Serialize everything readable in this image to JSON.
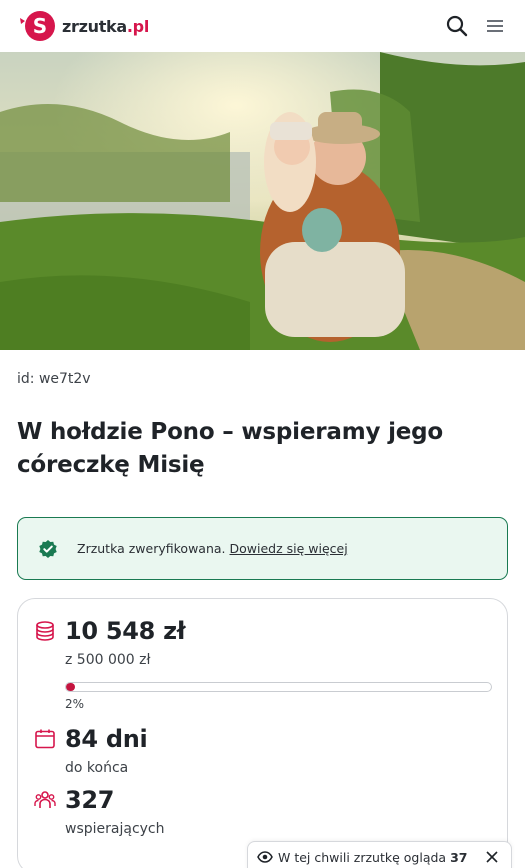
{
  "header": {
    "logo_text": "zrzutka",
    "logo_tld": ".pl",
    "search_icon": "search-icon",
    "menu_icon": "hamburger-menu-icon"
  },
  "campaign": {
    "id_label": "id: we7t2v",
    "title": "W hołdzie Pono – wspieramy jego córeczkę Misię"
  },
  "verified": {
    "icon": "verified-badge-icon",
    "text": "Zrzutka zweryfikowana.",
    "link": "Dowiedz się więcej"
  },
  "stats": {
    "raised": "10 548 zł",
    "goal": "z 500 000 zł",
    "progress_percent": 2,
    "progress_label": "2%",
    "days": "84 dni",
    "days_label": "do końca",
    "supporters": "327",
    "supporters_label": "wspierających"
  },
  "toast": {
    "text": "W tej chwili zrzutkę ogląda",
    "count": "37"
  },
  "colors": {
    "brand": "#d6164c",
    "verified_border": "#1a7a52",
    "verified_bg": "#eaf7f0",
    "progress_fill": "#c4143f"
  }
}
